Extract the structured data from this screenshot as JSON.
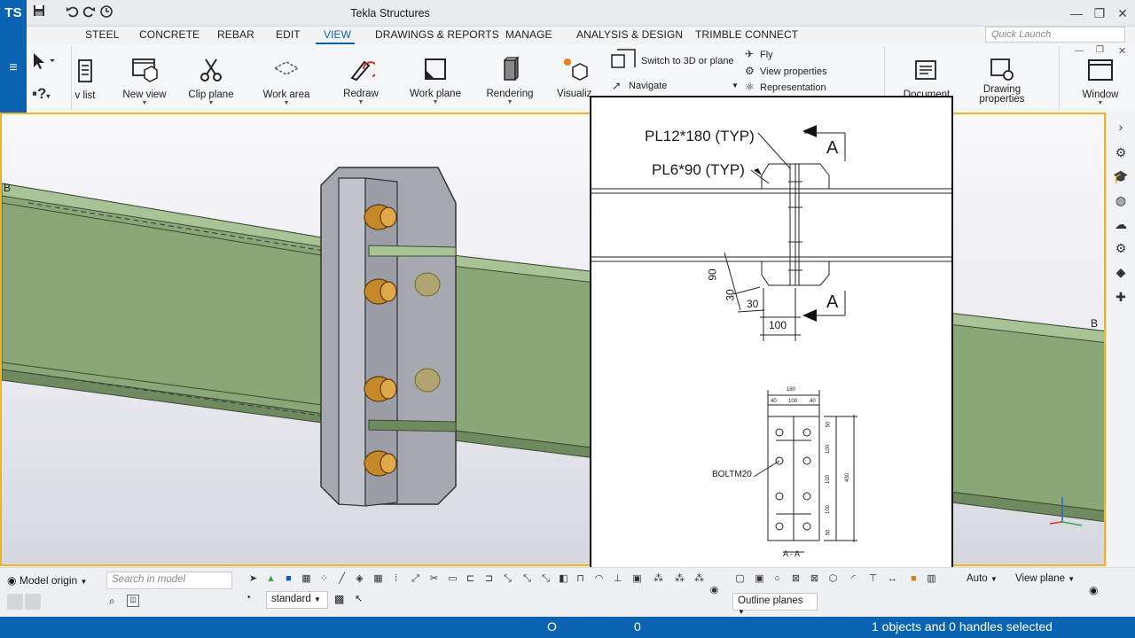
{
  "app": {
    "title": "Tekla Structures",
    "logo_text": "TS"
  },
  "quick_access": {
    "save": "save-icon",
    "undo": "undo-icon",
    "redo": "redo-icon",
    "history": "history-icon"
  },
  "window_controls": {
    "minimize": "—",
    "restore": "❐",
    "close": "✕"
  },
  "tabs": [
    "STEEL",
    "CONCRETE",
    "REBAR",
    "EDIT",
    "VIEW",
    "DRAWINGS & REPORTS",
    "MANAGE",
    "ANALYSIS & DESIGN",
    "TRIMBLE CONNECT"
  ],
  "active_tab": "VIEW",
  "search": {
    "placeholder": "Quick Launch"
  },
  "ribbon": {
    "view_list": "v list",
    "new_view": "New view",
    "clip_plane": "Clip plane",
    "work_area": "Work area",
    "redraw": "Redraw",
    "work_plane": "Work plane",
    "rendering": "Rendering",
    "visualize": "Visualiz",
    "switch_3d": "Switch to 3D or plane",
    "navigate": "Navigate",
    "fly": "Fly",
    "view_properties": "View properties",
    "representation": "Representation",
    "document": "Document",
    "drawing_properties_1": "Drawing",
    "drawing_properties_2": "properties",
    "window": "Window"
  },
  "model": {
    "grid_left": "B",
    "grid_right": "B"
  },
  "drawing": {
    "plate1": "PL12*180 (TYP)",
    "plate2": "PL6*90 (TYP)",
    "section_mark": "A",
    "dim_90": "90",
    "dim_30a": "30",
    "dim_30b": "30",
    "dim_100": "100",
    "sec_180": "180",
    "sec_40a": "40",
    "sec_100": "100",
    "sec_40b": "40",
    "sec_v50a": "50",
    "sec_v100a": "100",
    "sec_v100b": "100",
    "sec_v100c": "100",
    "sec_v50b": "50",
    "sec_v430": "430",
    "bolt_label": "BOLTM20",
    "section_title": "A - A"
  },
  "bottom": {
    "model_origin": "Model origin",
    "search_placeholder": "Search in model",
    "standard": "standard",
    "auto": "Auto",
    "view_plane": "View plane",
    "outline_planes": "Outline planes"
  },
  "status": {
    "field1": "O",
    "field2": "0",
    "selection": "1 objects and 0 handles selected"
  },
  "colors": {
    "accent": "#0a63b0",
    "viewport_border": "#f0b51c",
    "beam": "#8aa877",
    "plate": "#a7a9b1",
    "bolt": "#c48a2a"
  }
}
